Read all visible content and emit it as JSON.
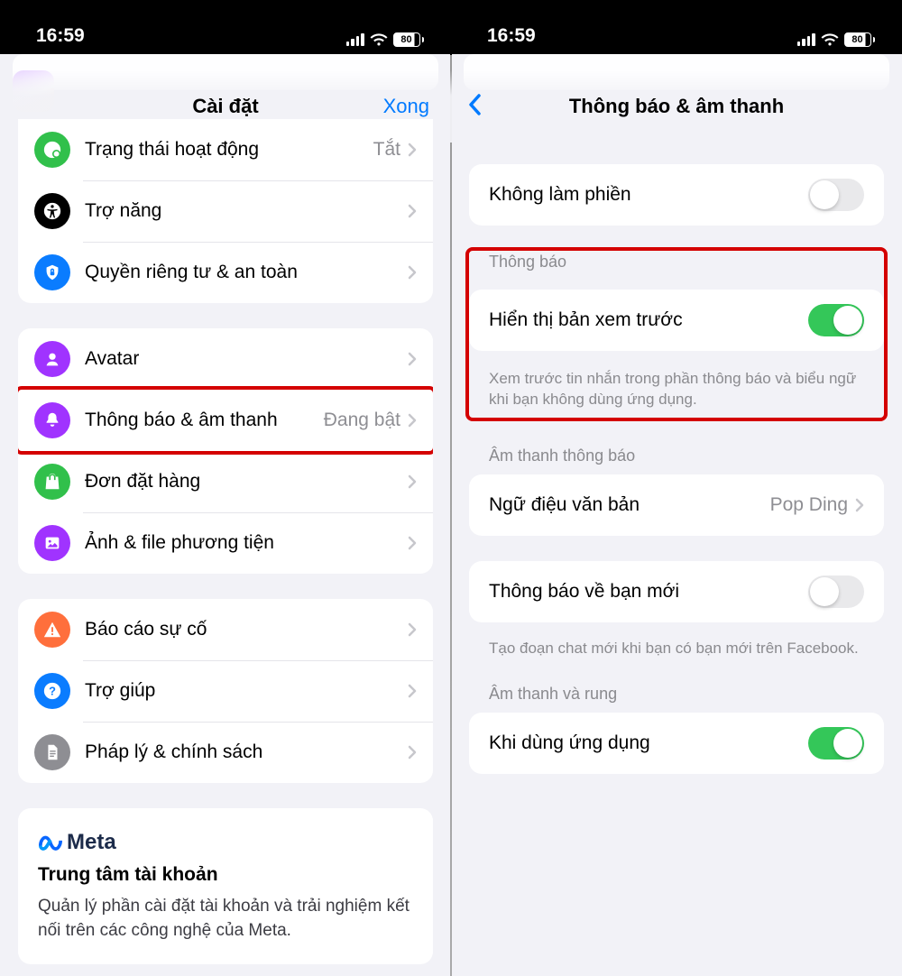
{
  "status": {
    "time": "16:59",
    "battery": "80"
  },
  "left": {
    "title": "Cài đặt",
    "done": "Xong",
    "rows": {
      "activity": {
        "label": "Trạng thái hoạt động",
        "value": "Tắt"
      },
      "accessibility": {
        "label": "Trợ năng"
      },
      "privacy": {
        "label": "Quyền riêng tư & an toàn"
      },
      "avatar": {
        "label": "Avatar"
      },
      "notifications": {
        "label": "Thông báo & âm thanh",
        "value": "Đang bật"
      },
      "orders": {
        "label": "Đơn đặt hàng"
      },
      "media": {
        "label": "Ảnh & file phương tiện"
      },
      "report": {
        "label": "Báo cáo sự cố"
      },
      "help": {
        "label": "Trợ giúp"
      },
      "legal": {
        "label": "Pháp lý & chính sách"
      }
    },
    "meta": {
      "brand": "Meta",
      "title": "Trung tâm tài khoản",
      "desc": "Quản lý phần cài đặt tài khoản và trải nghiệm kết nối trên các công nghệ của Meta."
    }
  },
  "right": {
    "title": "Thông báo & âm thanh",
    "dnd": {
      "label": "Không làm phiền"
    },
    "section_notif_header": "Thông báo",
    "preview": {
      "label": "Hiển thị bản xem trước"
    },
    "preview_footer": "Xem trước tin nhắn trong phần thông báo và biểu ngữ khi bạn không dùng ứng dụng.",
    "section_sound_header": "Âm thanh thông báo",
    "texttone": {
      "label": "Ngữ điệu văn bản",
      "value": "Pop Ding"
    },
    "newfriend": {
      "label": "Thông báo về bạn mới"
    },
    "newfriend_footer": "Tạo đoạn chat mới khi bạn có bạn mới trên Facebook.",
    "section_vibrate_header": "Âm thanh và rung",
    "inapp": {
      "label": "Khi dùng ứng dụng"
    }
  },
  "colors": {
    "green": "#31c04b",
    "black": "#000000",
    "blue": "#0a7cff",
    "purple": "#a033ff",
    "green2": "#31c04b",
    "purple2": "#a033ff",
    "orange": "#ff6f3c",
    "blue2": "#0a7cff",
    "gray": "#8e8e93"
  }
}
